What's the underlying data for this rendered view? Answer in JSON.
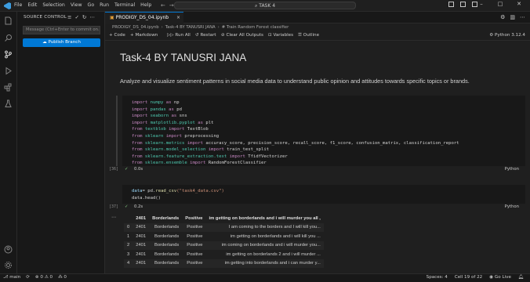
{
  "titlebar": {
    "menu": [
      "File",
      "Edit",
      "Selection",
      "View",
      "Go",
      "Run",
      "Terminal",
      "Help"
    ],
    "search_text": "TASK 4"
  },
  "activitybar": {
    "icons": [
      "explorer-icon",
      "search-icon",
      "source-control-icon",
      "run-debug-icon",
      "extensions-icon",
      "testing-icon",
      "account-icon",
      "settings-icon"
    ]
  },
  "sidebar": {
    "header": "SOURCE CONTROL",
    "commit_placeholder": "Message (Ctrl+Enter to commit on...",
    "publish_label": "Publish Branch"
  },
  "editor": {
    "tab_label": "PRODIGY_DS_04.ipynb",
    "breadcrumb": [
      "PRODIGY_DS_04.ipynb",
      "Task-4 BY TANUSRI JANA",
      "# Train Random Forest classifier"
    ],
    "toolbar": {
      "code": "+ Code",
      "markdown": "+ Markdown",
      "run_all": "Run All",
      "restart": "Restart",
      "clear_outputs": "Clear All Outputs",
      "variables": "Variables",
      "outline": "Outline",
      "kernel": "Python 3.12.4"
    }
  },
  "notebook": {
    "title": "Task-4 BY TANUSRI JANA",
    "description": "Analyze and visualize sentiment patterns in social media data to understand public opinion and attitudes towards specific topics or brands.",
    "cell1": {
      "lines": [
        [
          "import",
          " numpy ",
          "as",
          " np"
        ],
        [
          "import",
          " pandas ",
          "as",
          " pd"
        ],
        [
          "import",
          " seaborn ",
          "as",
          " sns"
        ],
        [
          "import",
          " matplotlib.pyplot ",
          "as",
          " plt"
        ],
        [
          "from",
          " textblob ",
          "import",
          " TextBlob"
        ],
        [
          "from",
          " sklearn ",
          "import",
          " preprocessing"
        ],
        [
          "from",
          " sklearn.metrics ",
          "import",
          " accuracy_score, precision_score, recall_score, f1_score, confusion_matrix, classification_report"
        ],
        [
          "from",
          " sklearn.model_selection ",
          "import",
          " train_test_split"
        ],
        [
          "from",
          " sklearn.feature_extraction.text ",
          "import",
          " TfidfVectorizer"
        ],
        [
          "from",
          " sklearn.ensemble ",
          "import",
          " RandomForestClassifier"
        ]
      ],
      "exec_count": "[36]",
      "time": "0.0s",
      "lang": "Python"
    },
    "cell2": {
      "line1_var": "data",
      "line1_rest": "= pd.",
      "line1_fn": "read_csv",
      "line1_str": "(\"task4_data.csv\")",
      "line2": "data.head()",
      "exec_count": "[37]",
      "time": "0.2s",
      "lang": "Python"
    },
    "output_table": {
      "headers": [
        "",
        "2401",
        "Borderlands",
        "Positive",
        "im getting on borderlands and i will murder you all ,"
      ],
      "rows": [
        [
          "0",
          "2401",
          "Borderlands",
          "Positive",
          "I am coming to the borders and I will kill you..."
        ],
        [
          "1",
          "2401",
          "Borderlands",
          "Positive",
          "im getting on borderlands and i will kill you ..."
        ],
        [
          "2",
          "2401",
          "Borderlands",
          "Positive",
          "im coming on borderlands and i will murder you..."
        ],
        [
          "3",
          "2401",
          "Borderlands",
          "Positive",
          "im getting on borderlands 2 and i will murder ..."
        ],
        [
          "4",
          "2401",
          "Borderlands",
          "Positive",
          "im getting into borderlands and i can murder y..."
        ]
      ]
    }
  },
  "statusbar": {
    "branch": "main",
    "sync": "⟳",
    "problems": "⊗ 0 ⚠ 0",
    "ports": "⁂ 0",
    "spaces": "Spaces: 4",
    "cell": "Cell 19 of 22",
    "golive": "Go Live"
  },
  "colors": {
    "accent": "#0078d4",
    "keyword": "#c586c0",
    "module": "#4ec9b0",
    "function": "#dcdcaa",
    "string": "#ce9178"
  }
}
